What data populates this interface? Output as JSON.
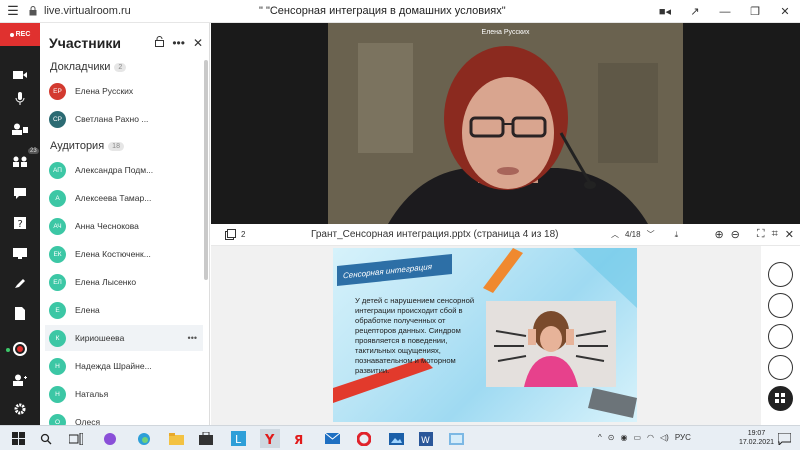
{
  "browser": {
    "url": "live.virtualroom.ru",
    "title": "\" \"Сенсорная интеграция в домашних условиях\""
  },
  "rail": {
    "rec_label": "REC",
    "participants_badge": "23"
  },
  "participants": {
    "heading": "Участники",
    "speakers_label": "Докладчики",
    "speakers_count": "2",
    "speakers": [
      {
        "initials": "ЕР",
        "name": "Елена Русских",
        "color": "#d33a2f"
      },
      {
        "initials": "СР",
        "name": "Светлана Рахно ...",
        "color": "#2c6b73"
      }
    ],
    "audience_label": "Аудитория",
    "audience_count": "18",
    "audience": [
      {
        "initials": "АП",
        "name": "Александра Подм..."
      },
      {
        "initials": "А",
        "name": "Алексеева Тамар..."
      },
      {
        "initials": "АЧ",
        "name": "Анна Чеснокова"
      },
      {
        "initials": "ЕК",
        "name": "Елена Костюченк..."
      },
      {
        "initials": "ЕЛ",
        "name": "Елена Лысенко"
      },
      {
        "initials": "Е",
        "name": "Елена"
      },
      {
        "initials": "К",
        "name": "Кириошеева"
      },
      {
        "initials": "Н",
        "name": "Надежда Шрайне..."
      },
      {
        "initials": "Н",
        "name": "Наталья"
      },
      {
        "initials": "О",
        "name": "Олеся"
      }
    ],
    "audience_color": "#3cc7a5"
  },
  "video": {
    "speaker_name": "Елена Русских"
  },
  "presentation": {
    "page_count_icon_value": "2",
    "file_title": "Грант_Сенсорная интеграция.pptx (страница 4 из 18)",
    "page_indicator": "4/18"
  },
  "slide": {
    "title": "Сенсорная интеграция",
    "text": "У детей с нарушением сенсорной интеграции происходит сбой в обработке полученных от рецепторов данных. Синдром проявляется в поведении, тактильных ощущениях, познавательном и моторном развитии."
  },
  "taskbar": {
    "language": "РУС",
    "time": "19:07",
    "date": "17.02.2021"
  },
  "colors": {
    "rec_red": "#e0312f",
    "rail_bg": "#1f1f1f",
    "slide_title_blue": "#2d6fa6"
  }
}
